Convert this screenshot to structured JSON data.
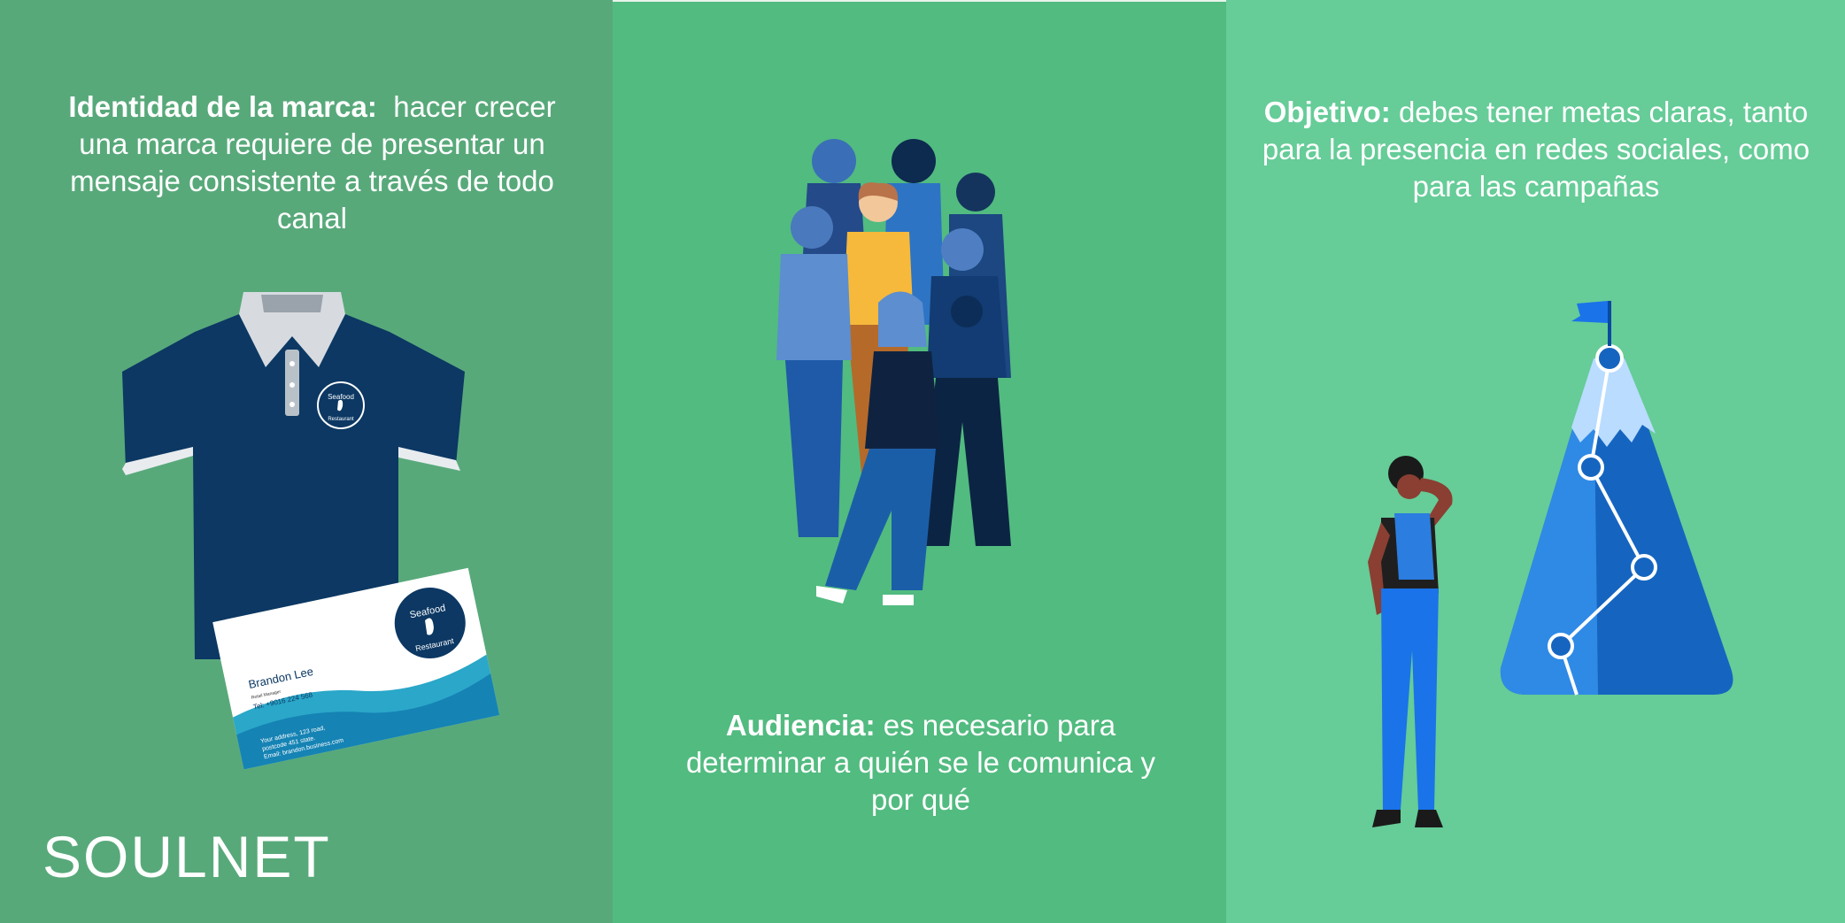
{
  "panels": [
    {
      "heading": "Identidad de la marca:",
      "body": "hacer crecer una marca requiere de presentar un mensaje consistente a través de todo canal"
    },
    {
      "heading": "Audiencia:",
      "body": "es necesario para determinar a quién se le comunica y por qué"
    },
    {
      "heading": "Objetivo:",
      "body": "debes tener metas claras, tanto para la presencia en redes sociales, como para las campañas"
    }
  ],
  "business_card": {
    "name": "Brandon Lee",
    "role": "Retail Manager",
    "tel": "Tel: +9016 224 568",
    "address": "Your address, 123 road,",
    "postcode": "postcode 451 state.",
    "email": "Email: brandon.business.com"
  },
  "shirt_logo": {
    "top": "Seafood",
    "bottom": "Restaurant"
  },
  "brand": {
    "logo_text": "SOULNET"
  },
  "colors": {
    "panel1": "#58a97a",
    "panel2": "#52bb80",
    "panel3": "#66cc98",
    "navy": "#0f3b66",
    "blue": "#1565c0"
  }
}
